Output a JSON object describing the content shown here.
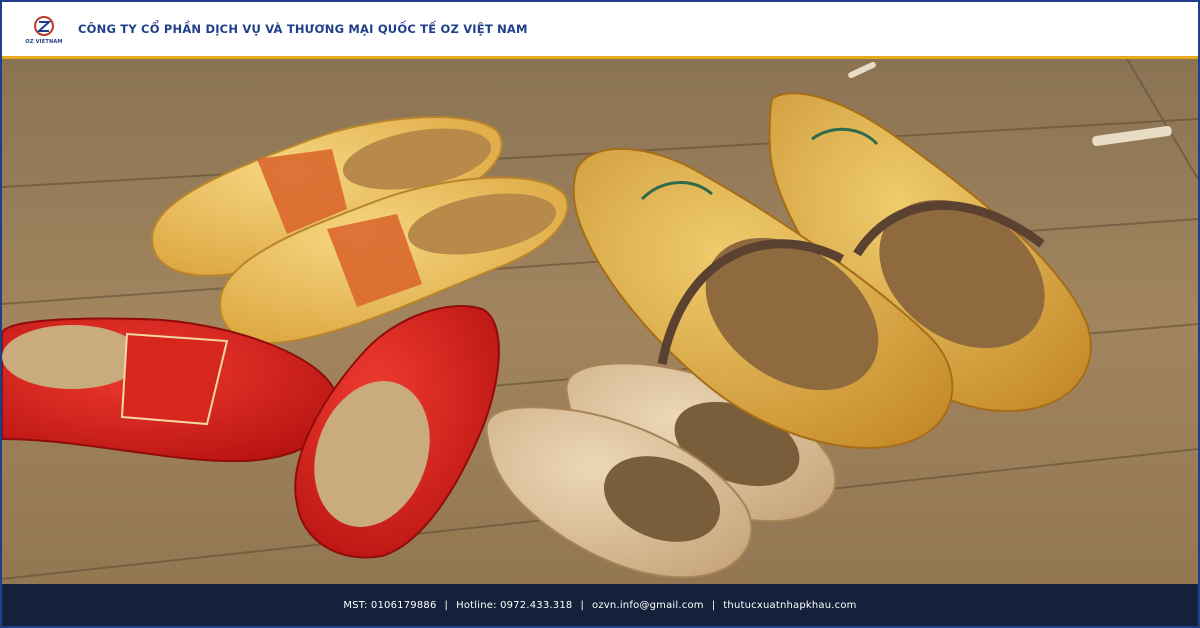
{
  "header": {
    "logo_text": "OZ VIETNAM",
    "company_name": "CÔNG TY CỔ PHẦN DỊCH VỤ VÀ THƯƠNG MẠI QUỐC TẾ OZ VIỆT NAM"
  },
  "footer": {
    "tax_id": "MST: 0106179886",
    "hotline": "Hotline: 0972.433.318",
    "email": "ozvn.info@gmail.com",
    "website": "thutucxuatnhapkhau.com",
    "separator": "|"
  },
  "colors": {
    "brand_blue": "#1f3f8a",
    "accent_gold": "#e6a817",
    "footer_bg": "#13213b"
  }
}
